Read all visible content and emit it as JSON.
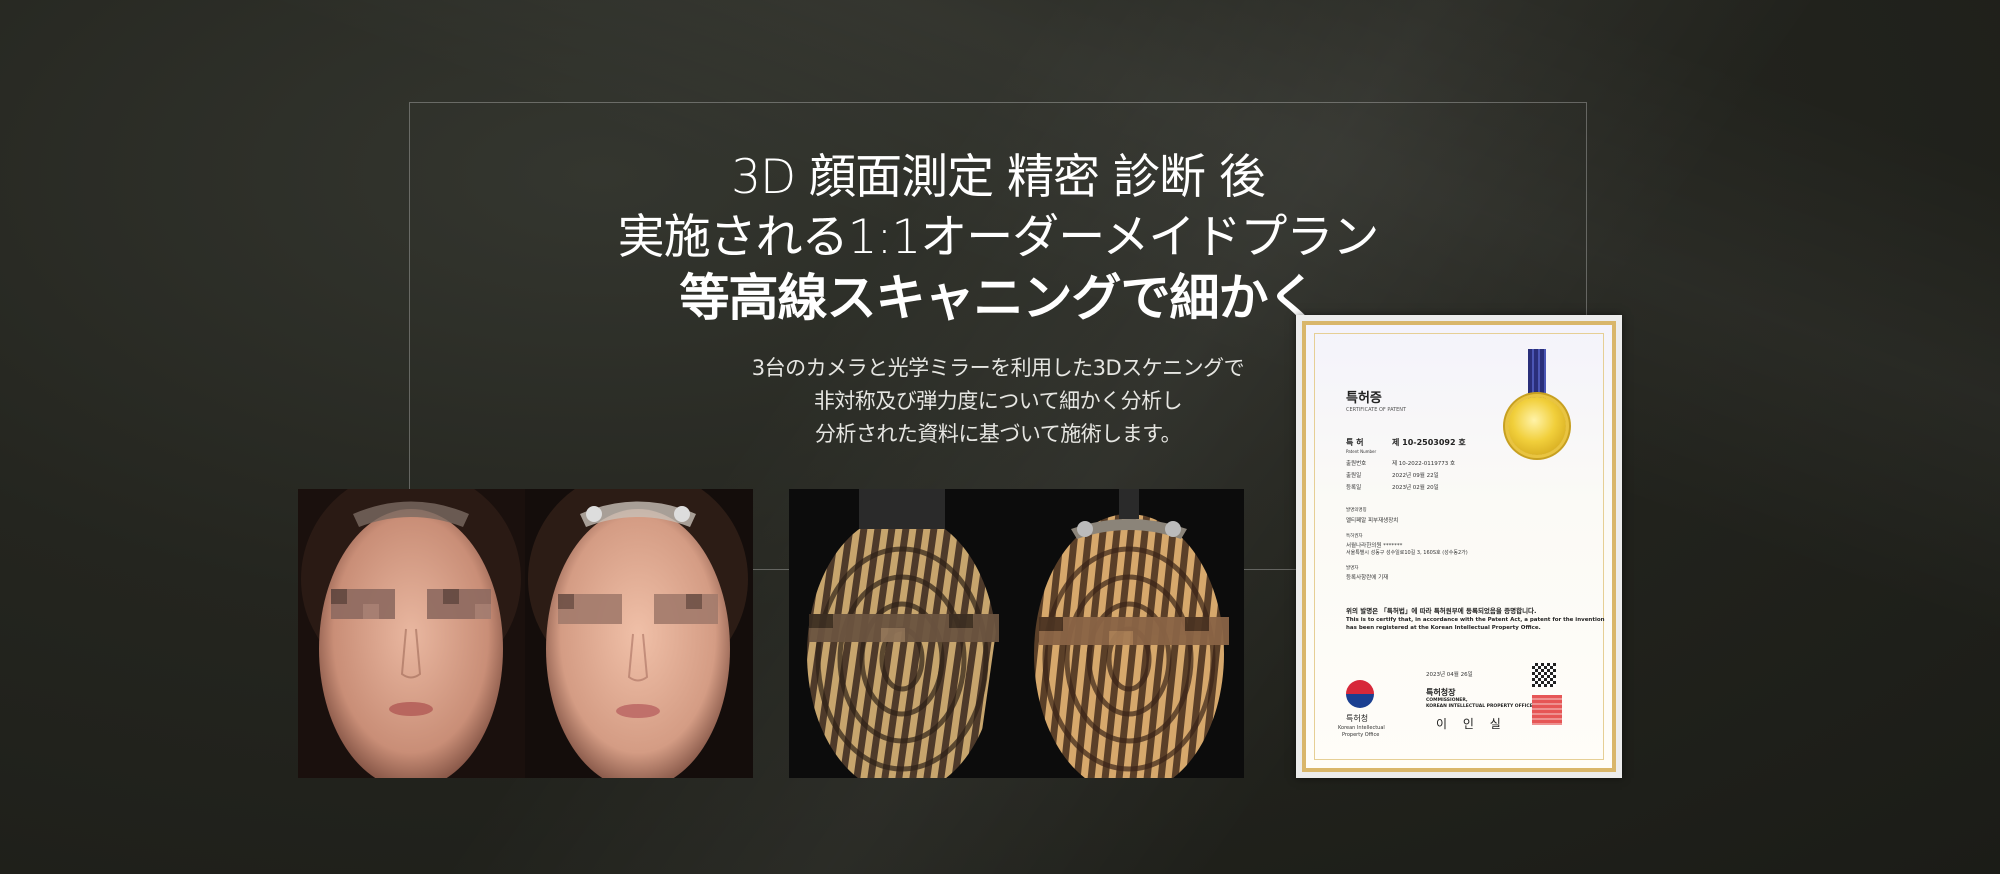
{
  "headline": {
    "line1": "3D 顔面測定 精密 診断 後",
    "line2": "実施される1:1オーダーメイドプラン",
    "line3": "等高線スキャニングで細かく"
  },
  "description": {
    "line1": "3台のカメラと光学ミラーを利用した3Dスケニングで",
    "line2": "非対称及び弾力度について細かく分析し",
    "line3": "分析された資料に基づいて施術します。"
  },
  "certificate": {
    "title": "특허증",
    "subtitle": "CERTIFICATE OF PATENT",
    "patent_label": "특 허",
    "patent_no": "제 10-2503092 호",
    "patent_number_caption": "Patent Number",
    "app_no_label": "출원번호",
    "app_no": "제 10-2022-0119773 호",
    "filing_label": "출원일",
    "filing_date": "2022년 09월 22일",
    "reg_label": "등록일",
    "reg_date": "2023년 02월 20일",
    "invention_label": "발명의명칭",
    "invention": "멜티페알 피부재생장치",
    "owner_label": "특허권자",
    "owner": "서월나라한의원 *******",
    "address": "서울특별시 성동구 성수일로10길 3, 160S호 (성수동2가)",
    "inventor_label": "발명자",
    "inventor": "등록사항란에 기재",
    "statement_ko": "위의 발명은 「특허법」에 따라 특허원부에 등록되었음을 증명합니다.",
    "statement_en1": "This is to certify that, in accordance with the Patent Act, a patent for the invention",
    "statement_en2": "has been registered at the Korean Intellectual Property Office.",
    "issue_date": "2023년 04월 26일",
    "commissioner_ko": "특허청장",
    "commissioner_en1": "COMMISSIONER,",
    "commissioner_en2": "KOREAN INTELLECTUAL PROPERTY OFFICE",
    "signature": "이 인 실",
    "office_ko": "특허청",
    "office_en1": "Korean Intellectual",
    "office_en2": "Property Office"
  },
  "colors": {
    "background": "#24251f",
    "frame_border": "#6b6b66",
    "cert_gold": "#d9b66a"
  }
}
